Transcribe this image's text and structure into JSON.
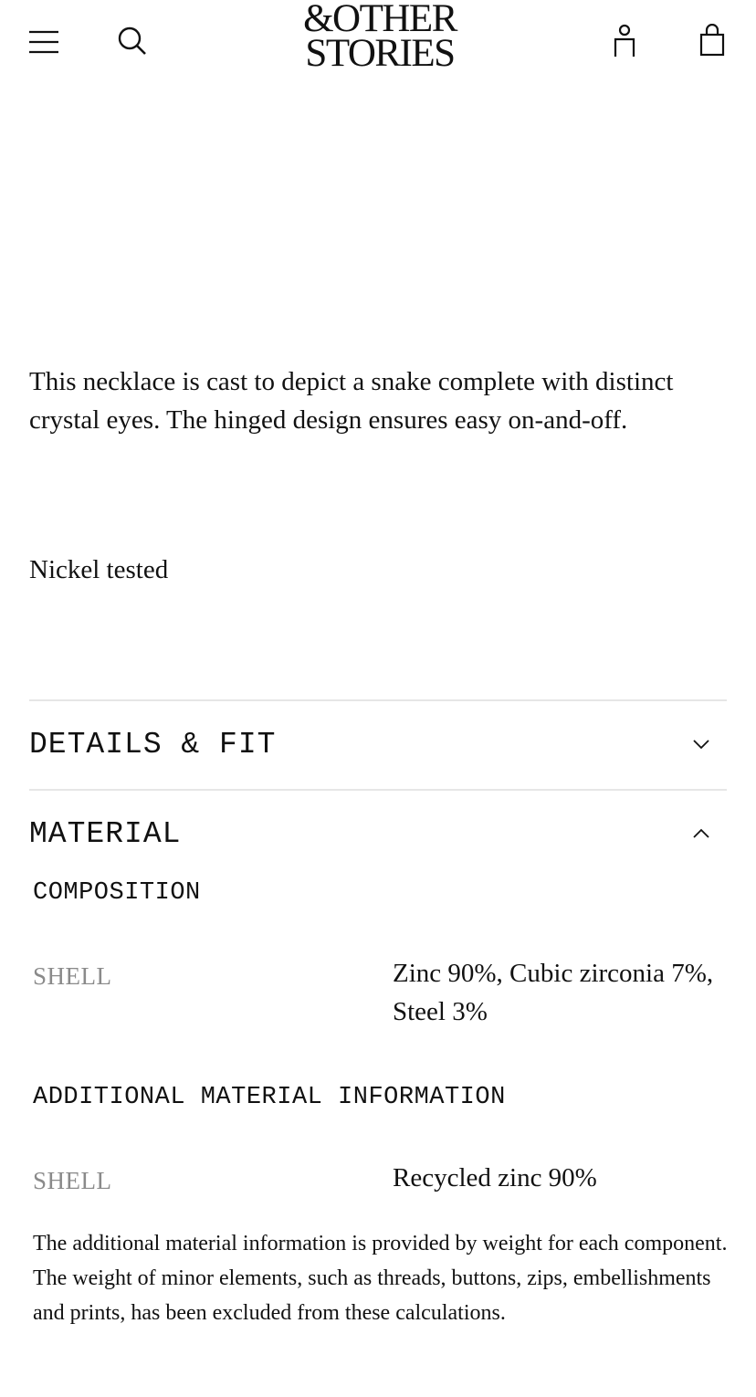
{
  "header": {
    "logo_line1": "&OTHER",
    "logo_line2": "STORIES",
    "icons": [
      "menu-icon",
      "search-icon",
      "account-icon",
      "bag-icon"
    ]
  },
  "product": {
    "description": "This necklace is cast to depict a snake complete with distinct crystal eyes. The hinged design ensures easy on-and-off.",
    "note": "Nickel tested"
  },
  "accordions": {
    "details": {
      "title": "DETAILS & FIT",
      "expanded": false
    },
    "material": {
      "title": "MATERIAL",
      "expanded": true,
      "composition_heading": "COMPOSITION",
      "composition_rows": [
        {
          "label": "SHELL",
          "value": "Zinc 90%, Cubic zirconia 7%, Steel 3%"
        }
      ],
      "additional_heading": "ADDITIONAL MATERIAL INFORMATION",
      "additional_rows": [
        {
          "label": "SHELL",
          "value": "Recycled zinc 90%"
        }
      ],
      "footnote": "The additional material information is provided by weight for each component. The weight of minor elements, such as threads, buttons, zips, embellishments and prints, has been excluded from these calculations."
    }
  },
  "colors": {
    "text": "#111111",
    "muted_label": "#8a8a8a",
    "divider": "#e6e6e6",
    "background": "#ffffff"
  }
}
